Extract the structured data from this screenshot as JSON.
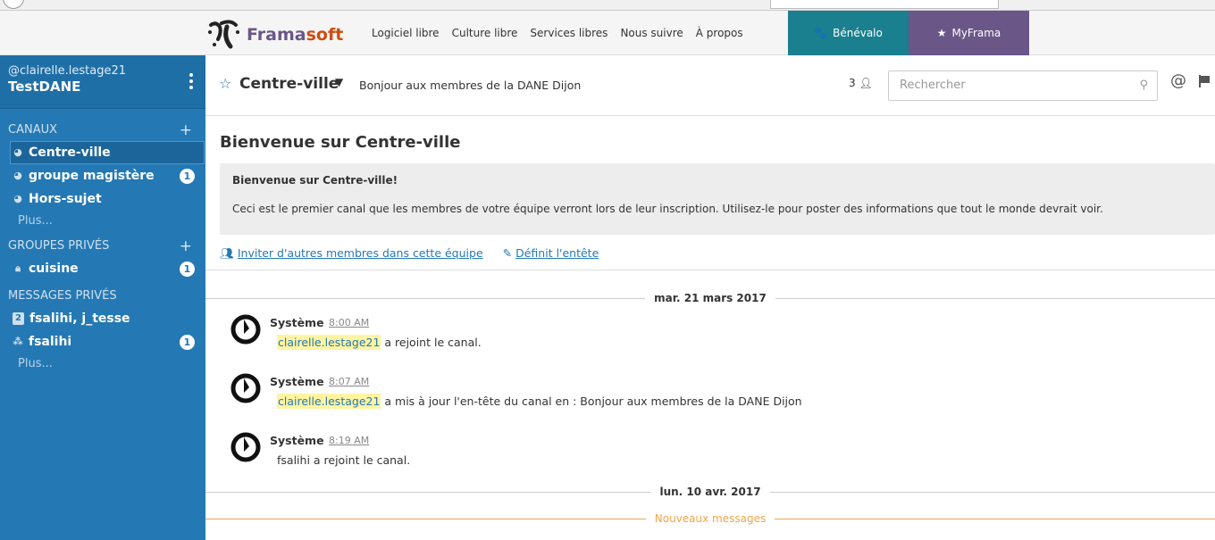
{
  "nav": {
    "logo_part1": "Frama",
    "logo_part2": "soft",
    "links": [
      "Logiciel libre",
      "Culture libre",
      "Services libres",
      "Nous suivre",
      "À propos"
    ],
    "benevalo": "Bénévalo",
    "myframa": "MyFrama"
  },
  "sidebar": {
    "user": "@clairelle.lestage21",
    "team": "TestDANE",
    "channels_title": "CANAUX",
    "channels": [
      {
        "label": "Centre-ville",
        "badge": ""
      },
      {
        "label": "groupe magistère",
        "badge": "1"
      },
      {
        "label": "Hors-sujet",
        "badge": ""
      }
    ],
    "channels_more": "Plus...",
    "private_title": "GROUPES PRIVÉS",
    "private": [
      {
        "label": "cuisine",
        "badge": "1"
      }
    ],
    "dm_title": "MESSAGES PRIVÉS",
    "dms": [
      {
        "count": "2",
        "label": "fsalihi, j_tesse",
        "badge": ""
      },
      {
        "label": "fsalihi",
        "badge": "1"
      }
    ],
    "dm_more": "Plus..."
  },
  "header": {
    "channel": "Centre-ville",
    "purpose": "Bonjour aux membres de la DANE Dijon",
    "members": "3",
    "search_placeholder": "Rechercher"
  },
  "intro": {
    "title": "Bienvenue sur Centre-ville",
    "box_title": "Bienvenue sur Centre-ville!",
    "box_body": "Ceci est le premier canal que les membres de votre équipe verront lors de leur inscription. Utilisez-le pour poster des informations que tout le monde devrait voir.",
    "invite": "Inviter d'autres membres dans cette équipe",
    "set_header": "Définit l'entête"
  },
  "dates": [
    "mar. 21 mars 2017",
    "lun. 10 avr. 2017"
  ],
  "new_messages": "Nouveaux messages",
  "posts": [
    {
      "user": "Système",
      "time": "8:00 AM",
      "mention": "clairelle.lestage21",
      "text": " a rejoint le canal."
    },
    {
      "user": "Système",
      "time": "8:07 AM",
      "mention": "clairelle.lestage21",
      "text": " a mis à jour l'en-tête du canal en : Bonjour aux membres de la DANE Dijon"
    },
    {
      "user": "Système",
      "time": "8:19 AM",
      "mention": "",
      "text": "fsalihi a rejoint le canal."
    }
  ],
  "colors": {
    "sidebar": "#2479b4",
    "benevalo": "#1a7f8e",
    "myframa": "#6a5687",
    "new_messages": "#f0a54a"
  }
}
